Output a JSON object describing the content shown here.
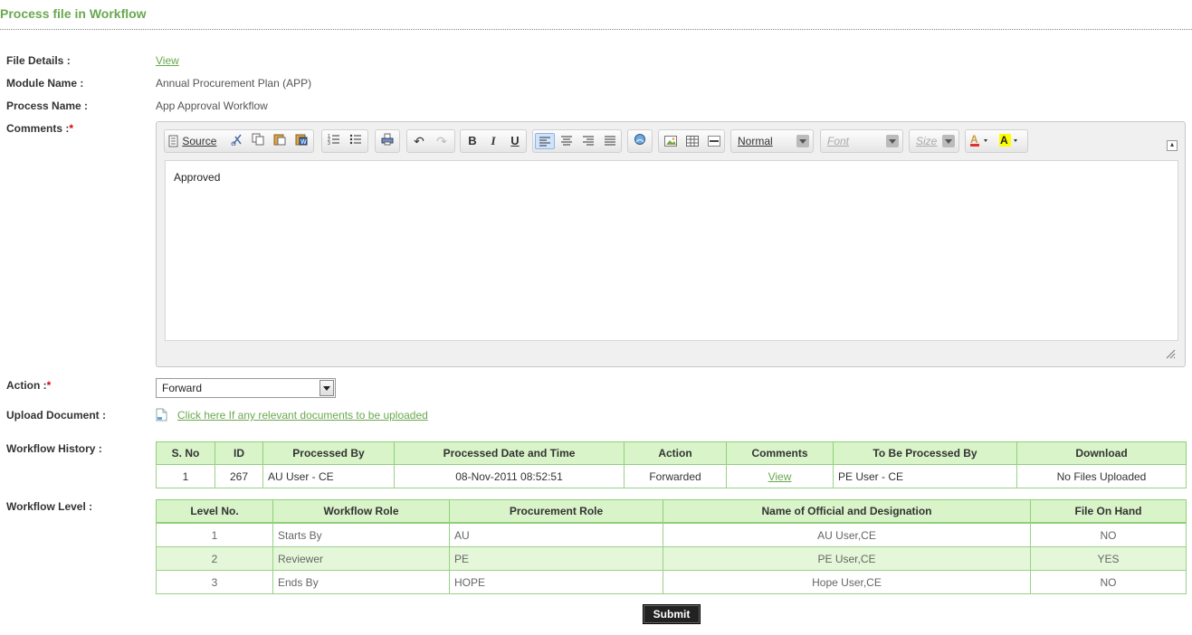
{
  "page": {
    "title": "Process file in Workflow"
  },
  "form": {
    "file_details_label": "File Details :",
    "file_details_link": "View",
    "module_label": "Module Name :",
    "module_value": "Annual Procurement Plan (APP)",
    "process_label": "Process Name :",
    "process_value": "App Approval Workflow",
    "comments_label": "Comments :",
    "required_mark": "*",
    "action_label": "Action :",
    "action_value": "Forward",
    "upload_label": "Upload Document :",
    "upload_link": "Click here If any relevant documents to be uploaded",
    "history_label": "Workflow History :",
    "level_label": "Workflow Level :"
  },
  "editor": {
    "source_label": "Source",
    "format_value": "Normal",
    "font_placeholder": "Font",
    "size_placeholder": "Size",
    "content": "Approved",
    "icons": [
      "source-icon",
      "cut-icon",
      "copy-icon",
      "paste-icon",
      "paste-word-icon",
      "numbered-list-icon",
      "bulleted-list-icon",
      "print-icon",
      "undo-icon",
      "redo-icon",
      "bold-icon",
      "italic-icon",
      "underline-icon",
      "align-left-icon",
      "align-center-icon",
      "align-right-icon",
      "justify-icon",
      "link-icon",
      "image-icon",
      "table-icon",
      "horizontal-rule-icon",
      "text-color-icon",
      "background-color-icon"
    ],
    "bold_glyph": "B",
    "italic_glyph": "I",
    "underline_glyph": "U"
  },
  "history": {
    "headers": [
      "S. No",
      "ID",
      "Processed By",
      "Processed Date and Time",
      "Action",
      "Comments",
      "To Be Processed By",
      "Download"
    ],
    "rows": [
      {
        "sno": "1",
        "id": "267",
        "processed_by": "AU User - CE",
        "datetime": "08-Nov-2011 08:52:51",
        "action": "Forwarded",
        "comments": "View",
        "to_be_processed_by": "PE User - CE",
        "download": "No Files Uploaded"
      }
    ]
  },
  "levels": {
    "headers": [
      "Level No.",
      "Workflow Role",
      "Procurement Role",
      "Name of Official and Designation",
      "File On Hand"
    ],
    "rows": [
      {
        "level": "1",
        "workflow_role": "Starts By",
        "procurement_role": "AU",
        "official": "AU User,CE",
        "file_on_hand": "NO"
      },
      {
        "level": "2",
        "workflow_role": "Reviewer",
        "procurement_role": "PE",
        "official": "PE User,CE",
        "file_on_hand": "YES"
      },
      {
        "level": "3",
        "workflow_role": "Ends By",
        "procurement_role": "HOPE",
        "official": "Hope User,CE",
        "file_on_hand": "NO"
      }
    ]
  },
  "submit_label": "Submit",
  "colors": {
    "accent": "#6aa84f",
    "header_bg": "#d9f4c9",
    "alt_row": "#e4f7d8",
    "border": "#8fd07a"
  }
}
